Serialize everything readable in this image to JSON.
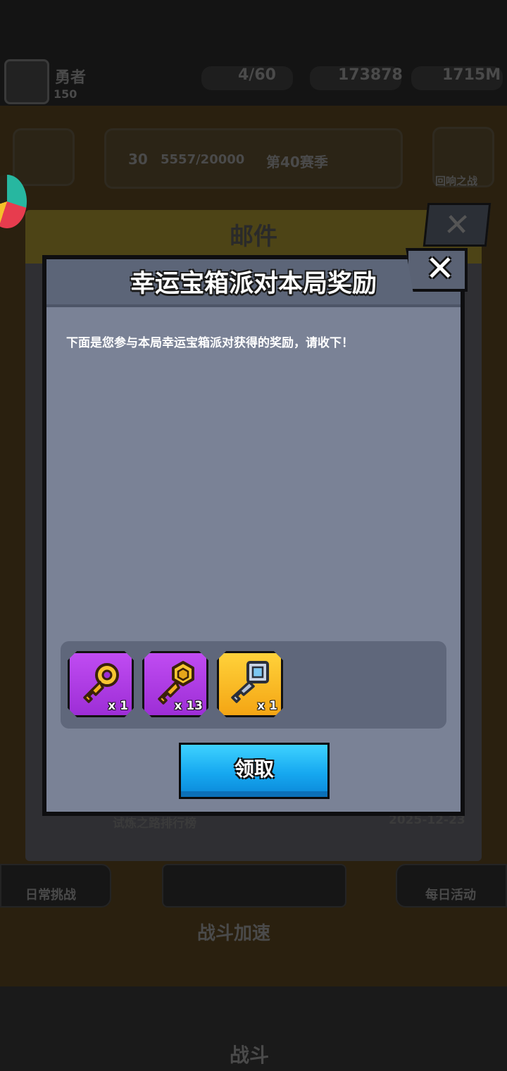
{
  "background": {
    "player_name": "勇者",
    "player_level": "150",
    "energy": "4/60",
    "gems": "173878",
    "coins": "1715M",
    "stage_level": "30",
    "stage_progress": "5557/20000",
    "rank_label": "第40赛季",
    "side_label": "回响之战",
    "bottom_left_label": "日常挑战",
    "bottom_right_label": "每日活动",
    "boost_label": "战斗加速",
    "battle_label": "战斗"
  },
  "mail": {
    "title": "邮件",
    "last_item_title": "试炼之路排行榜",
    "last_item_date": "2025-12-23"
  },
  "dialog": {
    "title": "幸运宝箱派对本局奖励",
    "message": "下面是您参与本局幸运宝箱派对获得的奖励，请收下！",
    "close_glyph": "✕",
    "rewards": [
      {
        "icon": "gold-key-icon",
        "quantity": "x 1",
        "frame_color": "#b13ee6"
      },
      {
        "icon": "hex-gold-key-icon",
        "quantity": "x 13",
        "frame_color": "#b13ee6"
      },
      {
        "icon": "silver-key-icon",
        "quantity": "x 1",
        "frame_color": "#f9bd22"
      }
    ],
    "claim_label": "领取"
  }
}
